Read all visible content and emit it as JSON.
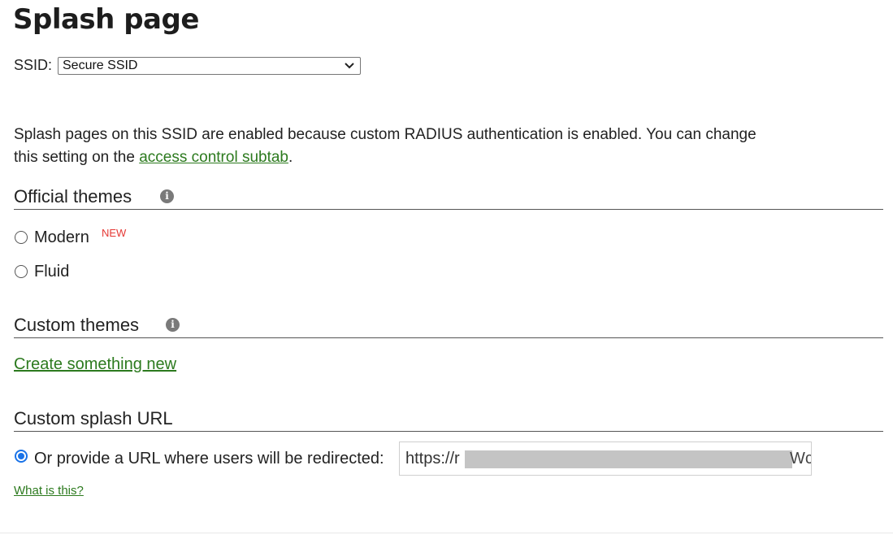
{
  "page": {
    "title": "Splash page"
  },
  "ssid": {
    "label": "SSID:",
    "selected": "Secure SSID"
  },
  "description": {
    "text_before": "Splash pages on this SSID are enabled because custom RADIUS authentication is enabled. You can change this setting on the ",
    "link_text": "access control subtab",
    "text_after": "."
  },
  "official_themes": {
    "title": "Official themes",
    "options": [
      {
        "label": "Modern",
        "badge": "NEW",
        "checked": false
      },
      {
        "label": "Fluid",
        "checked": false
      }
    ]
  },
  "custom_themes": {
    "title": "Custom themes",
    "create_link": "Create something new"
  },
  "custom_splash": {
    "title": "Custom splash URL",
    "option_label": "Or provide a URL where users will be redirected:",
    "checked": true,
    "url_prefix": "https://r",
    "url_suffix": "Wc",
    "help_link": "What is this?"
  },
  "colors": {
    "link": "#2c7a1e",
    "accent": "#1a73e8",
    "badge": "#e53935"
  }
}
